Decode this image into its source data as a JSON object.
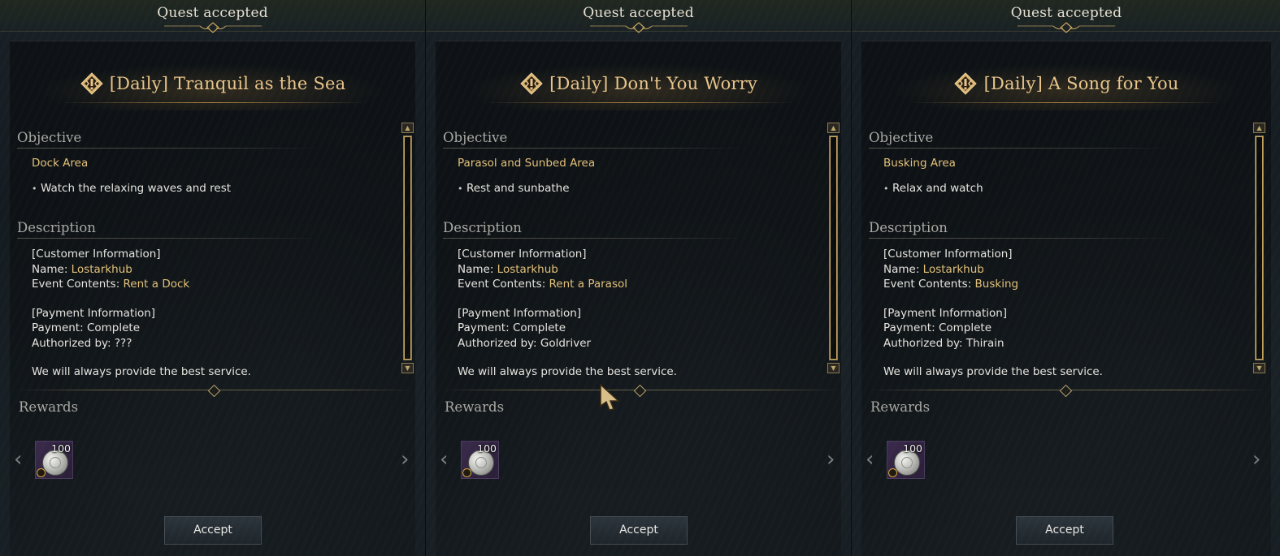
{
  "colors": {
    "gold_text": "#e2c07a",
    "title_gold": "#e7c48a",
    "section_header": "#a9a9a3",
    "body_text": "#e6e4df",
    "panel_bg": "#141b20",
    "reward_bg": "#2a1e38"
  },
  "icons": {
    "quest_icon": "daily-quest-icon",
    "header_ornament": "ornament-icon",
    "reward_coin": "silver-coin-icon",
    "reward_badge": "bound-item-badge-icon",
    "prev": "chevron-left-icon",
    "next": "chevron-right-icon",
    "scroll_up": "scroll-up-arrow-icon",
    "scroll_down": "scroll-down-arrow-icon"
  },
  "panels": [
    {
      "header": "Quest accepted",
      "quest_title": "[Daily] Tranquil as the Sea",
      "objective_header": "Objective",
      "objective_area": "Dock Area",
      "objective_task": "Watch the relaxing waves and rest",
      "description_header": "Description",
      "description": {
        "customer_header": "[Customer Information]",
        "name_label": "Name: ",
        "name_value": "Lostarkhub",
        "event_label": "Event Contents: ",
        "event_value": "Rent a Dock",
        "payment_header": "[Payment Information]",
        "payment_line": "Payment: Complete",
        "authorized_line": "Authorized by: ???",
        "closing": "We will always provide the best service."
      },
      "rewards_header": "Rewards",
      "reward": {
        "count": "100"
      },
      "accept_label": "Accept"
    },
    {
      "header": "Quest accepted",
      "quest_title": "[Daily] Don't You Worry",
      "objective_header": "Objective",
      "objective_area": "Parasol and Sunbed Area",
      "objective_task": "Rest and sunbathe",
      "description_header": "Description",
      "description": {
        "customer_header": "[Customer Information]",
        "name_label": "Name: ",
        "name_value": "Lostarkhub",
        "event_label": "Event Contents: ",
        "event_value": "Rent a Parasol",
        "payment_header": "[Payment Information]",
        "payment_line": "Payment: Complete",
        "authorized_line": "Authorized by: Goldriver",
        "closing": "We will always provide the best service."
      },
      "rewards_header": "Rewards",
      "reward": {
        "count": "100"
      },
      "accept_label": "Accept"
    },
    {
      "header": "Quest accepted",
      "quest_title": "[Daily] A Song for You",
      "objective_header": "Objective",
      "objective_area": "Busking Area",
      "objective_task": "Relax and watch",
      "description_header": "Description",
      "description": {
        "customer_header": "[Customer Information]",
        "name_label": "Name: ",
        "name_value": "Lostarkhub",
        "event_label": "Event Contents: ",
        "event_value": "Busking",
        "payment_header": "[Payment Information]",
        "payment_line": "Payment: Complete",
        "authorized_line": "Authorized by: Thirain",
        "closing": "We will always provide the best service."
      },
      "rewards_header": "Rewards",
      "reward": {
        "count": "100"
      },
      "accept_label": "Accept"
    }
  ]
}
